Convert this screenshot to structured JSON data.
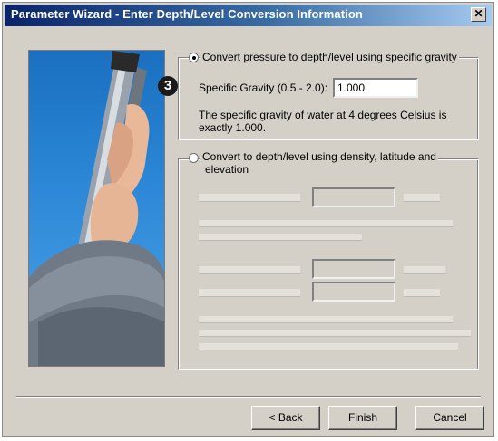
{
  "window": {
    "title": "Parameter Wizard - Enter Depth/Level Conversion Information",
    "close_glyph": "✕"
  },
  "step_badge": "3",
  "option_gravity": {
    "label": "Convert pressure to depth/level using specific gravity",
    "selected": true,
    "field_label": "Specific Gravity (0.5 - 2.0):",
    "field_value": "1.000",
    "note_line1": "The specific gravity of water at 4 degrees Celsius is",
    "note_line2": "exactly 1.000."
  },
  "option_density": {
    "label_line1": "Convert to depth/level using density, latitude and",
    "label_line2": "elevation",
    "selected": false
  },
  "buttons": {
    "back": "< Back",
    "finish": "Finish",
    "cancel": "Cancel"
  }
}
